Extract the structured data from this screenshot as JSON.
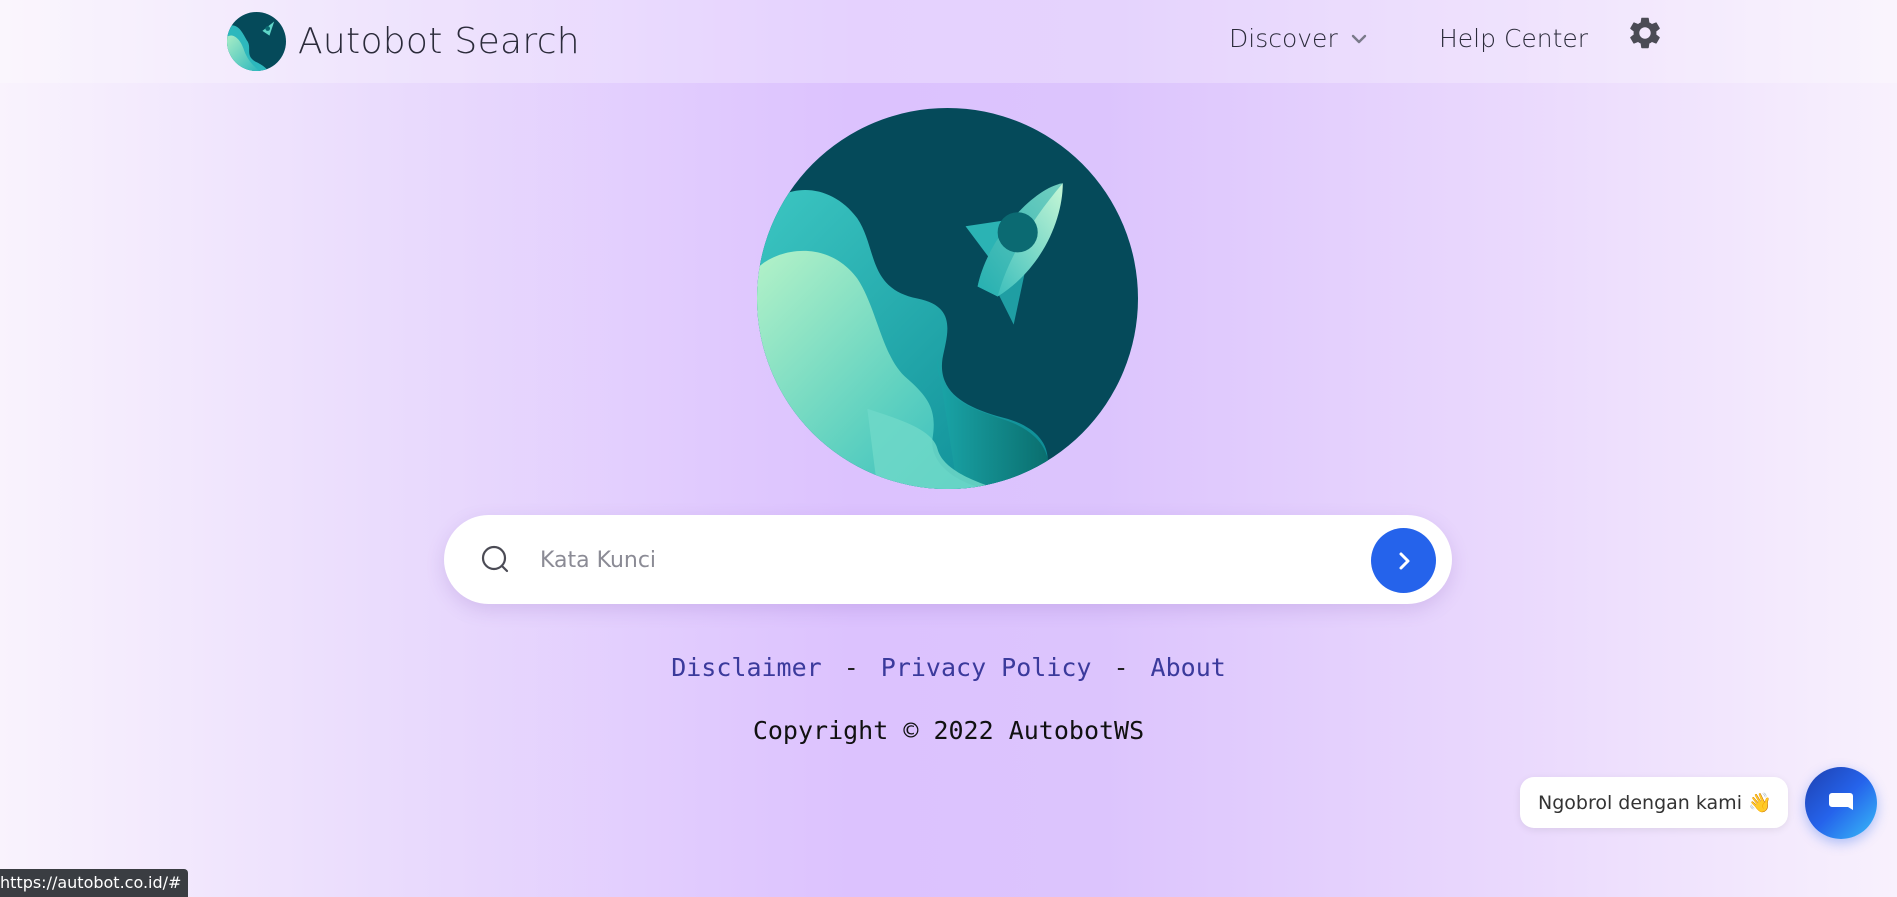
{
  "header": {
    "brand_name": "Autobot Search",
    "nav": {
      "discover_label": "Discover",
      "help_label": "Help Center"
    },
    "settings_icon": "gear-icon"
  },
  "search": {
    "placeholder": "Kata Kunci",
    "value": "",
    "search_icon": "search-icon",
    "submit_icon": "chevron-right-icon"
  },
  "footer": {
    "links": {
      "disclaimer": "Disclaimer",
      "privacy": "Privacy Policy",
      "about": "About",
      "separator": "-"
    },
    "copyright": "Copyright © 2022 AutobotWS"
  },
  "chat": {
    "prompt": "Ngobrol dengan kami",
    "wave_emoji": "👋",
    "icon": "chat-icon"
  },
  "status_bar": {
    "url": "https://autobot.co.id/#"
  },
  "colors": {
    "accent_blue": "#2563eb",
    "link_color": "#3b3a9c",
    "logo_dark_teal": "#054a5a",
    "logo_teal": "#2db8bd",
    "logo_mint": "#a8edc6"
  }
}
